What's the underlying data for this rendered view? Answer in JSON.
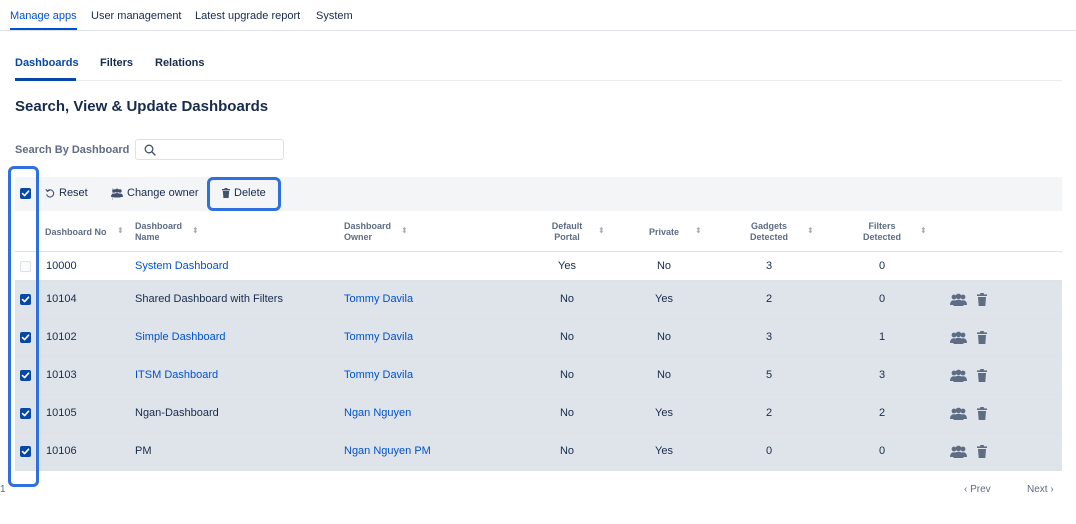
{
  "top_nav": {
    "tabs": [
      "Manage apps",
      "User management",
      "Latest upgrade report",
      "System"
    ]
  },
  "sub_nav": {
    "tabs": [
      "Dashboards",
      "Filters",
      "Relations"
    ]
  },
  "page_title": "Search, View & Update Dashboards",
  "search": {
    "label": "Search By Dashboard",
    "value": "",
    "placeholder": ""
  },
  "toolbar": {
    "reset": "Reset",
    "change_owner": "Change owner",
    "delete": "Delete"
  },
  "table": {
    "headers": {
      "no": "Dashboard No",
      "name_1": "Dashboard",
      "name_2": "Name",
      "owner_1": "Dashboard",
      "owner_2": "Owner",
      "portal_1": "Default",
      "portal_2": "Portal",
      "private": "Private",
      "gadgets_1": "Gadgets",
      "gadgets_2": "Detected",
      "filters_1": "Filters",
      "filters_2": "Detected"
    },
    "rows": [
      {
        "no": "10000",
        "name": "System Dashboard",
        "owner": "",
        "portal": "Yes",
        "private": "No",
        "gadgets": "3",
        "filters": "0",
        "selected": false
      },
      {
        "no": "10104",
        "name": "Shared Dashboard with Filters",
        "owner": "Tommy Davila",
        "portal": "No",
        "private": "Yes",
        "gadgets": "2",
        "filters": "0",
        "selected": true
      },
      {
        "no": "10102",
        "name": "Simple Dashboard",
        "owner": "Tommy Davila",
        "portal": "No",
        "private": "No",
        "gadgets": "3",
        "filters": "1",
        "selected": true
      },
      {
        "no": "10103",
        "name": "ITSM Dashboard",
        "owner": "Tommy Davila",
        "portal": "No",
        "private": "No",
        "gadgets": "5",
        "filters": "3",
        "selected": true
      },
      {
        "no": "10105",
        "name": "Ngan-Dashboard",
        "owner": "Ngan Nguyen",
        "portal": "No",
        "private": "Yes",
        "gadgets": "2",
        "filters": "2",
        "selected": true
      },
      {
        "no": "10106",
        "name": "PM",
        "owner": "Ngan Nguyen PM",
        "portal": "No",
        "private": "Yes",
        "gadgets": "0",
        "filters": "0",
        "selected": true
      }
    ]
  },
  "pagination": {
    "prev": "Prev",
    "page": "1",
    "next": "Next"
  },
  "colors": {
    "accent": "#0052cc",
    "checkbox": "#0747a6",
    "selected_row": "#dfe4ea",
    "highlight": "#2f6fe0"
  }
}
